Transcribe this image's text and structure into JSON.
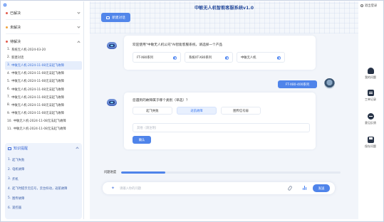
{
  "app": {
    "title": "中敏无人机智能客服系统v1.0"
  },
  "sidebar": {
    "sections": {
      "done": {
        "label": "已解决",
        "color": "#e25a4b"
      },
      "todo": {
        "label": "未解决",
        "color": "#f1a33b"
      },
      "ing": {
        "label": "待解决",
        "color": "#e25a4b"
      }
    },
    "history": [
      {
        "idx": "1.",
        "text": "系统无人机-2024-03-20"
      },
      {
        "idx": "2.",
        "text": "新建对话"
      },
      {
        "idx": "3.",
        "text": "中敏无人机-2024-11-08无法起飞故障"
      },
      {
        "idx": "4.",
        "text": "中敏无人机-2024-11-08无法起飞故障"
      },
      {
        "idx": "5.",
        "text": "中敏无人机-2024-11-08无法起飞故障"
      },
      {
        "idx": "6.",
        "text": "中敏无人机-2024-11-08无法起飞故障"
      },
      {
        "idx": "7.",
        "text": "中敏无人机-2024-11-08无法起飞故障"
      },
      {
        "idx": "8.",
        "text": "中敏无人机-2024-11-08无法起飞故障"
      },
      {
        "idx": "9.",
        "text": "中敏无人机-2024-11-08无法起飞故障"
      },
      {
        "idx": "10.",
        "text": "中敏无人机-2024-11-08无法起飞故障"
      },
      {
        "idx": "11.",
        "text": "中敏无人机-2024-11-08无法起飞故障"
      }
    ],
    "knowledge": {
      "title": "知识提醒",
      "items": [
        {
          "idx": "1.",
          "text": "起飞失败"
        },
        {
          "idx": "2.",
          "text": "电机故障"
        },
        {
          "idx": "3.",
          "text": "炸机"
        },
        {
          "idx": "4.",
          "text": "起飞时提示无信号，云台抖动，返航故障"
        },
        {
          "idx": "5.",
          "text": "图传故障"
        },
        {
          "idx": "6.",
          "text": "遥控器"
        }
      ]
    }
  },
  "main": {
    "new_chat_label": "新建对话",
    "welcome": "欢迎使用\"中敏无人机公司\"AI智能客服系统，请选择一个产品",
    "products": [
      "FT-X80系列",
      "系统XT-X80系列",
      "中敏无人机"
    ],
    "user_message": "FT-X80-400系列",
    "question": "您遇到的故障属于哪个类别（单选）？",
    "choices": [
      "起飞失败",
      "返航故障",
      "图传信号弱"
    ],
    "other_placeholder": "其他（请注明）",
    "confirm_label": "确认",
    "progress_label": "问题进度",
    "progress_value": 0.2,
    "input_placeholder": "请输入你的问题",
    "send_label": "发送"
  },
  "rightbar": {
    "logout": "退出登录",
    "tools": [
      "我的问题",
      "工单记录",
      "意见反馈",
      "保存问题"
    ]
  }
}
